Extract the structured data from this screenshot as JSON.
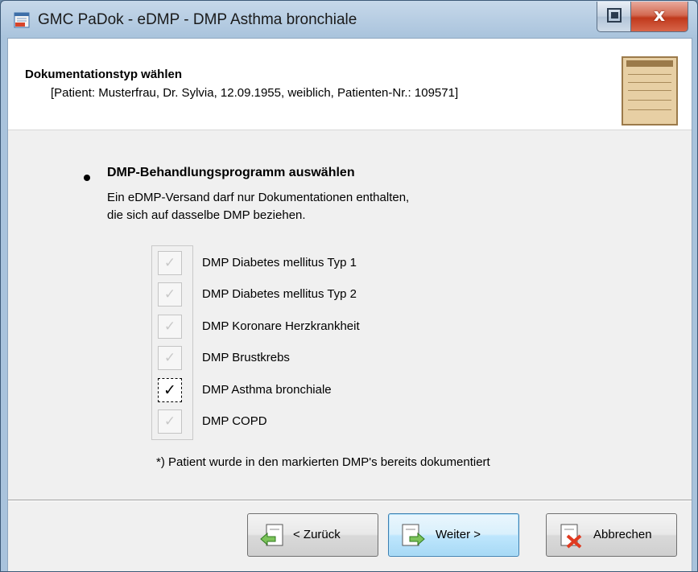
{
  "window": {
    "title": "GMC PaDok - eDMP - DMP Asthma bronchiale",
    "icons": {
      "app": "edmp-app-icon",
      "restore": "restore-icon",
      "close": "close-icon"
    },
    "close_glyph": "x"
  },
  "header": {
    "title": "Dokumentationstyp wählen",
    "patient_info": "[Patient: Musterfrau, Dr. Sylvia, 12.09.1955, weiblich, Patienten-Nr.: 109571]",
    "image_icon": "form-document-icon"
  },
  "section": {
    "title": "DMP-Behandlungsprogramm auswählen",
    "line1": "Ein eDMP-Versand darf nur Dokumentationen enthalten,",
    "line2": "die sich auf dasselbe DMP beziehen."
  },
  "programs": [
    {
      "label": "DMP Diabetes mellitus Typ 1",
      "checked": true,
      "enabled": false
    },
    {
      "label": "DMP Diabetes mellitus Typ 2",
      "checked": true,
      "enabled": false
    },
    {
      "label": "DMP Koronare Herzkrankheit",
      "checked": true,
      "enabled": false
    },
    {
      "label": "DMP Brustkrebs",
      "checked": true,
      "enabled": false
    },
    {
      "label": "DMP Asthma bronchiale",
      "checked": true,
      "enabled": true
    },
    {
      "label": "DMP COPD",
      "checked": true,
      "enabled": false
    }
  ],
  "check_glyph": "✓",
  "footnote": "*) Patient wurde in den markierten DMP's bereits dokumentiert",
  "buttons": {
    "back": "< Zurück",
    "next": "Weiter >",
    "cancel": "Abbrechen"
  },
  "colors": {
    "accent": "#3c7fb1",
    "title_bar": "#a9c3dc",
    "cancel_icon": "#e03a20"
  }
}
